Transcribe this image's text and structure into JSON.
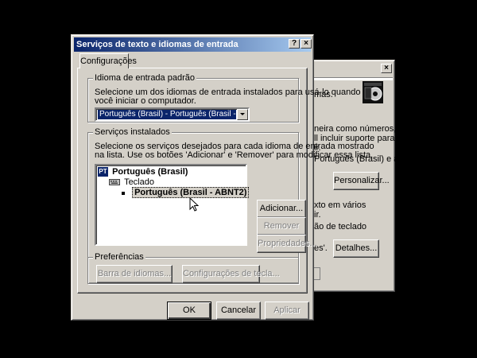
{
  "bg_dialog": {
    "fragments": [
      "mas.",
      "neira como números,",
      "ll incluir suporte para",
      "ir.",
      "Português (Brasil) e a",
      "xto em vários",
      "ir.",
      "ão de teclado",
      "es'."
    ],
    "personalize_label": "Personalizar...",
    "details_label": "Detalhes...",
    "close_glyph": "×"
  },
  "dialog": {
    "title": "Serviços de texto e idiomas de entrada",
    "help_glyph": "?",
    "close_glyph": "×",
    "tab_label": "Configurações",
    "default_lang": {
      "group_label": "Idioma de entrada padrão",
      "desc_line1": "Selecione um dos idiomas de entrada instalados para usá-lo quando",
      "desc_line2": "você iniciar o computador.",
      "selected_value": "Português (Brasil) - Português (Brasil - ABNT2)"
    },
    "installed": {
      "group_label": "Serviços instalados",
      "desc_line1": "Selecione os serviços desejados para cada idioma de entrada mostrado",
      "desc_line2": "na lista. Use os botões 'Adicionar' e 'Remover' para modificar essa lista.",
      "tree": {
        "lang_code": "PT",
        "lang_name": "Português (Brasil)",
        "category": "Teclado",
        "layout": "Português (Brasil - ABNT2)"
      },
      "add_label": "Adicionar...",
      "remove_label": "Remover",
      "properties_label": "Propriedades..."
    },
    "preferences": {
      "group_label": "Preferências",
      "langbar_label": "Barra de idiomas...",
      "keysettings_label": "Configurações de tecla..."
    },
    "ok_label": "OK",
    "cancel_label": "Cancelar",
    "apply_label": "Aplicar"
  }
}
